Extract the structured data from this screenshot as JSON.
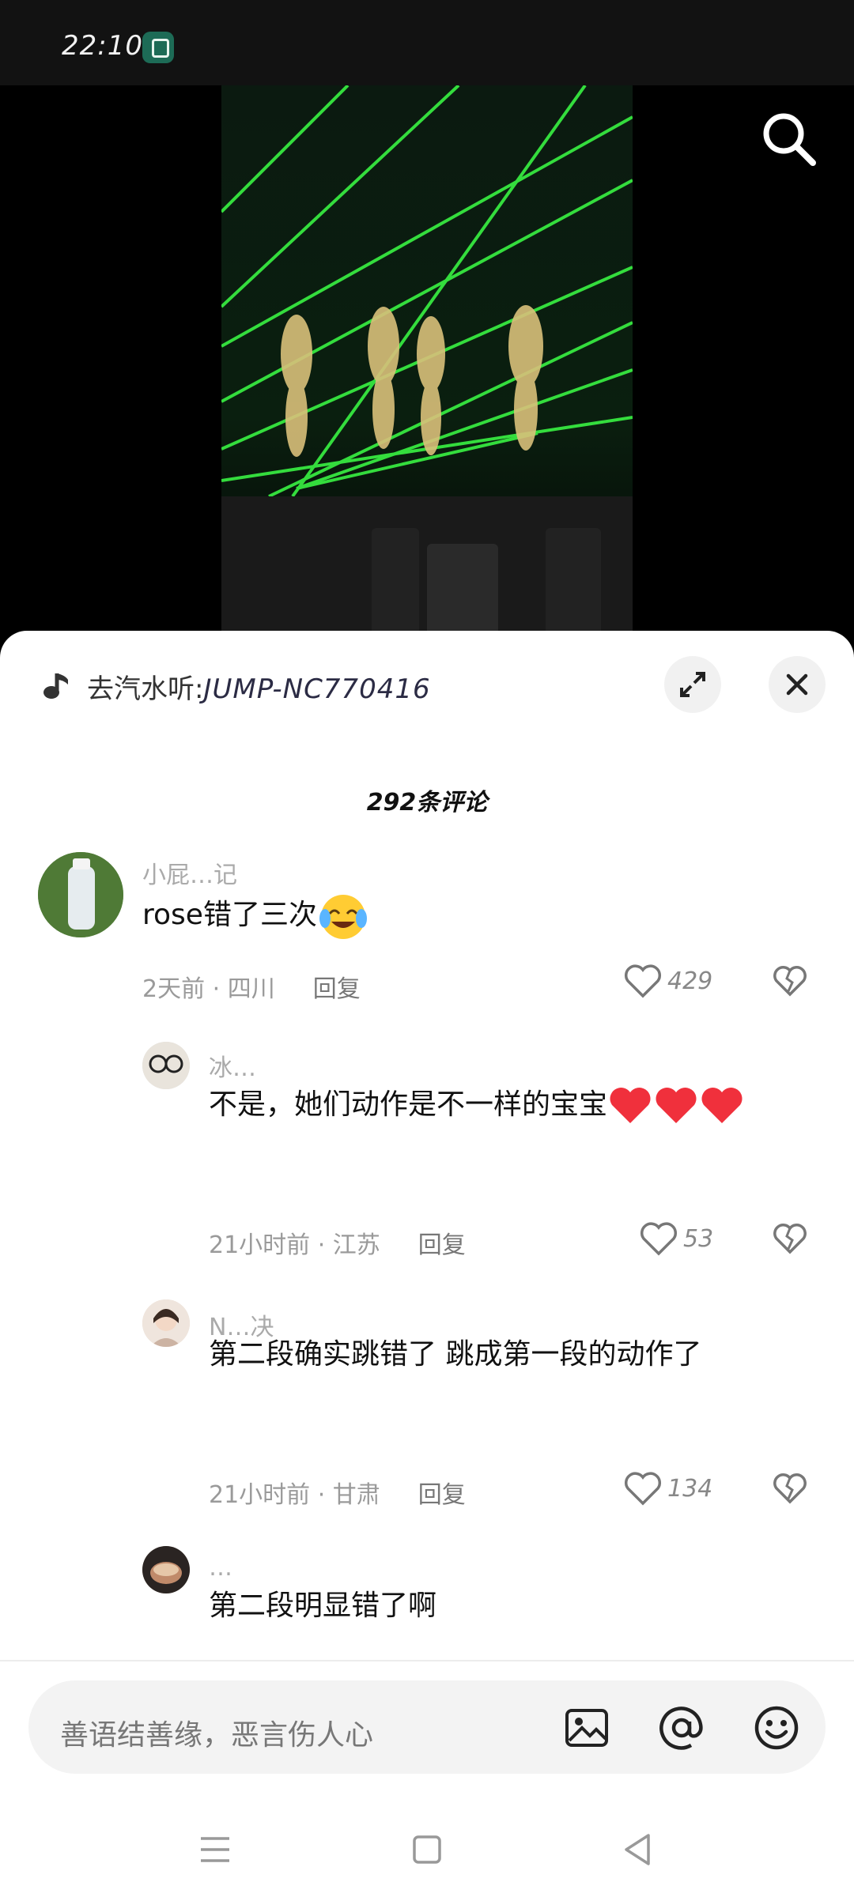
{
  "status_bar": {
    "time": "22:10"
  },
  "music": {
    "label": "去汽水听:",
    "code": "JUMP-NC770416"
  },
  "comments_count": "292条评论",
  "comments": [
    {
      "user": "小屁…记",
      "text": "rose错了三次",
      "time": "2天前",
      "location": "四川",
      "reply_label": "回复",
      "likes": "429"
    },
    {
      "user": "冰…",
      "text": "不是，她们动作是不一样的宝宝",
      "time": "21小时前",
      "location": "江苏",
      "reply_label": "回复",
      "likes": "53"
    },
    {
      "user": "N…决",
      "text": "第二段确实跳错了 跳成第一段的动作了",
      "time": "21小时前",
      "location": "甘肃",
      "reply_label": "回复",
      "likes": "134"
    },
    {
      "user": "…",
      "text": "第二段明显错了啊"
    }
  ],
  "input": {
    "placeholder": "善语结善缘，恶言伤人心"
  },
  "icons": [
    "search-icon",
    "music-icon",
    "expand-icon",
    "close-icon",
    "heart-icon",
    "broken-heart-icon",
    "image-icon",
    "at-icon",
    "emoji-icon",
    "menu-icon",
    "home-icon",
    "back-icon"
  ],
  "colors": {
    "laser": "#39ff4a",
    "heart": "#f0303c"
  }
}
